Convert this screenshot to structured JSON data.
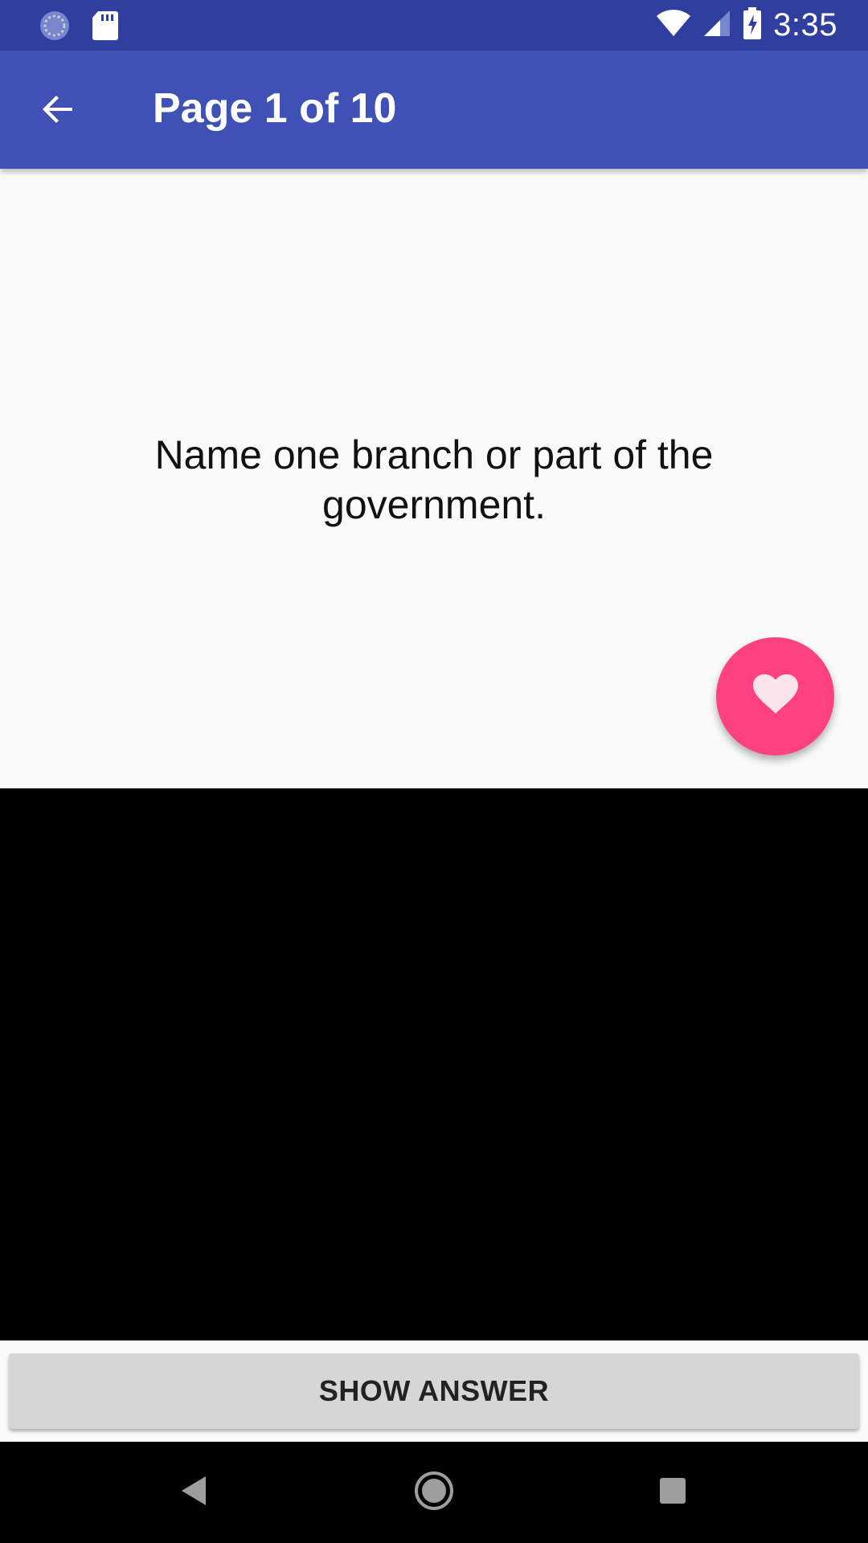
{
  "status_bar": {
    "time": "3:35",
    "icons": [
      "loading-icon",
      "sd-card-icon",
      "wifi-icon",
      "signal-icon",
      "battery-charging-icon"
    ]
  },
  "app_bar": {
    "title": "Page 1 of 10",
    "back_icon": "arrow-back-icon"
  },
  "card": {
    "question": "Name one branch or part of the government."
  },
  "fab": {
    "icon": "heart-icon",
    "color": "#FF4081"
  },
  "actions": {
    "show_answer_label": "SHOW ANSWER"
  },
  "nav_bar": {
    "icons": [
      "back-triangle-icon",
      "home-circle-icon",
      "recents-square-icon"
    ]
  },
  "colors": {
    "primary": "#3F51B5",
    "primary_dark": "#303F9F",
    "accent": "#FF4081"
  }
}
